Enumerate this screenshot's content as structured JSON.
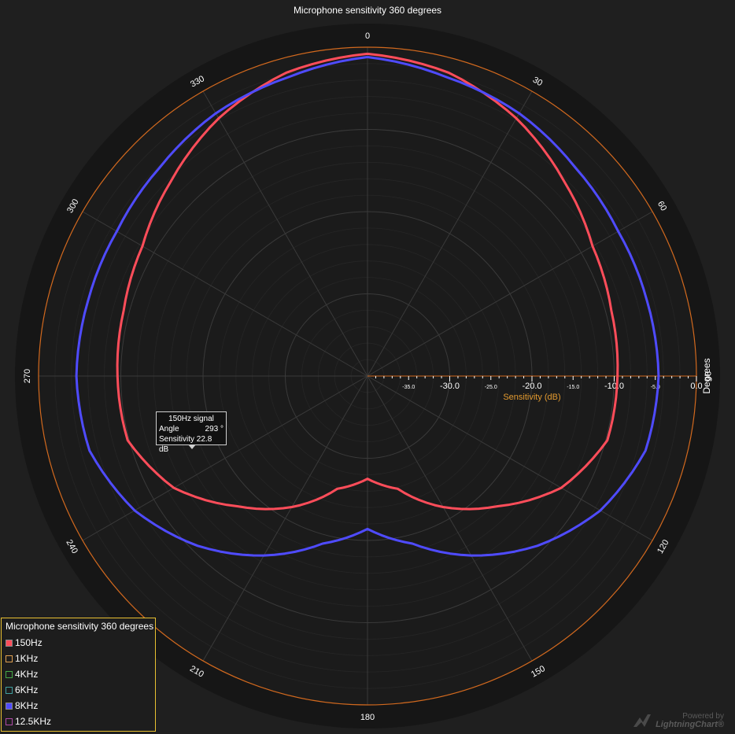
{
  "chart_data": {
    "type": "polar-line",
    "title": "Microphone sensitivity 360 degrees",
    "angle_axis": {
      "title": "Degrees",
      "ticks": [
        "0",
        "30",
        "60",
        "90",
        "120",
        "150",
        "180",
        "210",
        "240",
        "270",
        "300",
        "330"
      ]
    },
    "radial_axis": {
      "title": "Sensitivity (dB)",
      "range": [
        -40,
        0
      ],
      "major_ticks": [
        "-30.0",
        "-20.0",
        "-10.0",
        "0.0"
      ],
      "minor_ticks": [
        "-35.0",
        "-25.0",
        "-15.0",
        "-5.0"
      ]
    },
    "series": [
      {
        "name": "150Hz",
        "color": "#ff4d5a",
        "angles": [
          0,
          15,
          30,
          45,
          60,
          75,
          90,
          105,
          120,
          135,
          150,
          165,
          180,
          195,
          210,
          225,
          240,
          255,
          270,
          285,
          300,
          315,
          330,
          345
        ],
        "values": [
          -0.8,
          -1.8,
          -3.8,
          -6.3,
          -8.4,
          -9.3,
          -9.6,
          -9.8,
          -12.8,
          -17.6,
          -21.6,
          -25.8,
          -27.5,
          -25.8,
          -21.6,
          -17.6,
          -12.8,
          -9.8,
          -9.6,
          -9.3,
          -8.4,
          -6.3,
          -3.8,
          -1.8
        ]
      },
      {
        "name": "1KHz",
        "color": "#e0a050",
        "values": []
      },
      {
        "name": "4KHz",
        "color": "#46a846",
        "values": []
      },
      {
        "name": "6KHz",
        "color": "#3fa0a0",
        "values": []
      },
      {
        "name": "8KHz",
        "color": "#4f4bff",
        "angles": [
          0,
          15,
          30,
          45,
          60,
          75,
          90,
          105,
          120,
          135,
          150,
          165,
          180,
          195,
          210,
          225,
          240,
          255,
          270,
          285,
          300,
          315,
          330,
          345
        ],
        "values": [
          -1.2,
          -2.4,
          -3.1,
          -4.2,
          -4.8,
          -4.8,
          -4.6,
          -5.0,
          -7.3,
          -10.8,
          -14.8,
          -18.9,
          -21.4,
          -18.9,
          -14.8,
          -10.8,
          -7.3,
          -5.0,
          -4.6,
          -4.8,
          -4.8,
          -4.2,
          -3.1,
          -2.4
        ]
      },
      {
        "name": "12.5KHz",
        "color": "#b04aa8",
        "values": []
      }
    ]
  },
  "legend": {
    "title": "Microphone sensitivity 360 degrees",
    "items": [
      {
        "label": "150Hz",
        "color": "#ff4d5a"
      },
      {
        "label": "1KHz",
        "color": "#e0a050"
      },
      {
        "label": "4KHz",
        "color": "#46a846"
      },
      {
        "label": "6KHz",
        "color": "#3fa0a0"
      },
      {
        "label": "8KHz",
        "color": "#4f4bff"
      },
      {
        "label": "12.5KHz",
        "color": "#b04aa8"
      }
    ]
  },
  "tooltip": {
    "title": "150Hz signal",
    "angle_label": "Angle",
    "angle_value": "293 °",
    "sensitivity_text": "Sensitivity 22.8 dB"
  },
  "watermark": {
    "line1": "Powered by",
    "line2": "LightningChart®"
  }
}
